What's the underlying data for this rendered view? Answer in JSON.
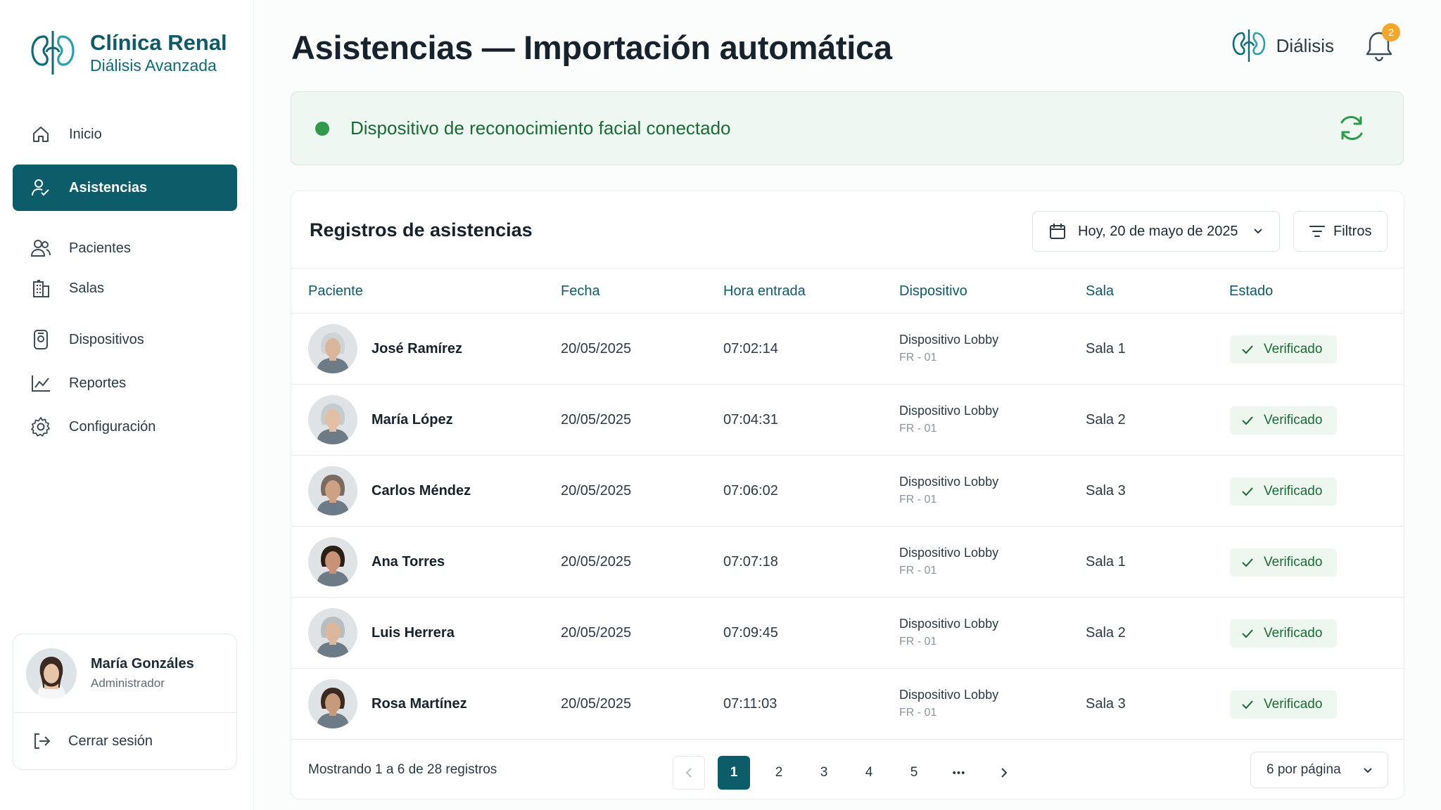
{
  "brand": {
    "title": "Clínica Renal",
    "subtitle": "Diálisis Avanzada"
  },
  "sidebar": {
    "items": [
      {
        "label": "Inicio",
        "icon": "home-icon",
        "active": false
      },
      {
        "label": "Asistencias",
        "icon": "user-check-icon",
        "active": true
      },
      {
        "label": "Pacientes",
        "icon": "users-icon",
        "active": false
      },
      {
        "label": "Salas",
        "icon": "building-icon",
        "active": false
      },
      {
        "label": "Dispositivos",
        "icon": "device-icon",
        "active": false
      },
      {
        "label": "Reportes",
        "icon": "chart-icon",
        "active": false
      },
      {
        "label": "Configuración",
        "icon": "gear-icon",
        "active": false
      }
    ]
  },
  "user": {
    "name": "María Gonzáles",
    "role": "Administrador",
    "logout_label": "Cerrar sesión"
  },
  "header": {
    "title": "Asistencias — Importación automática",
    "module_label": "Diálisis",
    "notification_count": "2"
  },
  "banner": {
    "text": "Dispositivo de reconocimiento facial conectado",
    "status_color": "#2f9a4a"
  },
  "table": {
    "title": "Registros de asistencias",
    "date_filter": "Hoy, 20 de mayo de 2025",
    "filters_label": "Filtros",
    "columns": [
      "Paciente",
      "Fecha",
      "Hora entrada",
      "Dispositivo",
      "Sala",
      "Estado"
    ],
    "rows": [
      {
        "patient": "José Ramírez",
        "date": "20/05/2025",
        "time": "07:02:14",
        "device": "Dispositivo Lobby",
        "device_id": "FR - 01",
        "room": "Sala 1",
        "status": "Verificado"
      },
      {
        "patient": "María López",
        "date": "20/05/2025",
        "time": "07:04:31",
        "device": "Dispositivo Lobby",
        "device_id": "FR - 01",
        "room": "Sala 2",
        "status": "Verificado"
      },
      {
        "patient": "Carlos Méndez",
        "date": "20/05/2025",
        "time": "07:06:02",
        "device": "Dispositivo Lobby",
        "device_id": "FR - 01",
        "room": "Sala 3",
        "status": "Verificado"
      },
      {
        "patient": "Ana Torres",
        "date": "20/05/2025",
        "time": "07:07:18",
        "device": "Dispositivo Lobby",
        "device_id": "FR - 01",
        "room": "Sala 1",
        "status": "Verificado"
      },
      {
        "patient": "Luis Herrera",
        "date": "20/05/2025",
        "time": "07:09:45",
        "device": "Dispositivo Lobby",
        "device_id": "FR - 01",
        "room": "Sala 2",
        "status": "Verificado"
      },
      {
        "patient": "Rosa Martínez",
        "date": "20/05/2025",
        "time": "07:11:03",
        "device": "Dispositivo Lobby",
        "device_id": "FR - 01",
        "room": "Sala 3",
        "status": "Verificado"
      }
    ],
    "showing": "Mostrando 1 a 6 de 28 registros",
    "pages": [
      "1",
      "2",
      "3",
      "4",
      "5"
    ],
    "ellipsis": "•••",
    "per_page": "6 por página"
  },
  "colors": {
    "primary": "#0d5c6a",
    "success": "#1b6b36",
    "badge": "#f4a62a"
  }
}
